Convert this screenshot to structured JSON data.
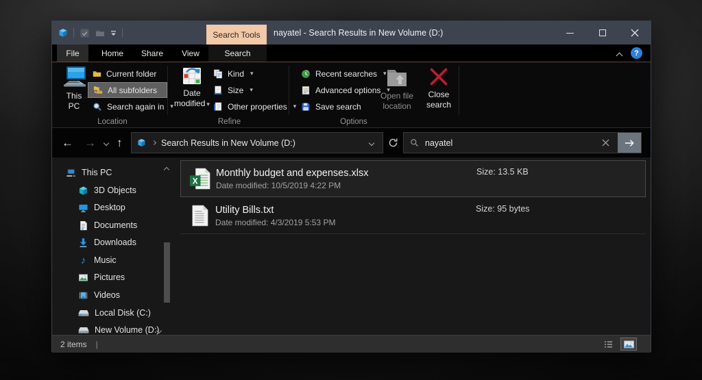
{
  "window": {
    "title": "nayatel - Search Results in New Volume (D:)",
    "contextual_tab_label": "Search Tools"
  },
  "menu": {
    "tabs": [
      {
        "label": "File"
      },
      {
        "label": "Home"
      },
      {
        "label": "Share"
      },
      {
        "label": "View"
      },
      {
        "label": "Search",
        "active": true
      }
    ]
  },
  "ribbon": {
    "location": {
      "this_pc_line1": "This",
      "this_pc_line2": "PC",
      "current_folder": "Current folder",
      "all_subfolders": "All subfolders",
      "search_again_in": "Search again in",
      "group_label": "Location"
    },
    "refine": {
      "date_modified_line1": "Date",
      "date_modified_line2": "modified",
      "kind": "Kind",
      "size": "Size",
      "other_properties": "Other properties",
      "group_label": "Refine"
    },
    "options": {
      "recent_searches": "Recent searches",
      "advanced_options": "Advanced options",
      "save_search": "Save search",
      "open_file_location_line1": "Open file",
      "open_file_location_line2": "location",
      "close_search_line1": "Close",
      "close_search_line2": "search",
      "group_label": "Options"
    }
  },
  "address_bar": {
    "path": "Search Results in New Volume (D:)",
    "search_query": "nayatel"
  },
  "sidebar": {
    "items": [
      {
        "label": "This PC"
      },
      {
        "label": "3D Objects"
      },
      {
        "label": "Desktop"
      },
      {
        "label": "Documents"
      },
      {
        "label": "Downloads"
      },
      {
        "label": "Music"
      },
      {
        "label": "Pictures"
      },
      {
        "label": "Videos"
      },
      {
        "label": "Local Disk (C:)"
      },
      {
        "label": "New Volume (D:)"
      }
    ]
  },
  "files": [
    {
      "name": "Monthly budget and expenses.xlsx",
      "date_modified": "Date modified: 10/5/2019 4:22 PM",
      "size": "Size: 13.5 KB",
      "type": "excel",
      "selected": true
    },
    {
      "name": "Utility Bills.txt",
      "date_modified": "Date modified: 4/3/2019 5:53 PM",
      "size": "Size: 95 bytes",
      "type": "text",
      "selected": false
    }
  ],
  "status_bar": {
    "items_count": "2 items",
    "divider": "|"
  },
  "icons": {
    "caret_down": "▾",
    "help": "?",
    "back_arrow": "←",
    "forward_arrow": "→",
    "up_arrow": "↑",
    "music_note": "♪"
  },
  "colors": {
    "titlebar": "#3d4450",
    "contextual_tab": "#f2c9a9",
    "close_search_x": "#c41a30",
    "selection_gray": "#5f5f5f",
    "accent_blue": "#2196e0",
    "folder_yellow": "#e2b94f",
    "excel_green": "#1d7044"
  }
}
